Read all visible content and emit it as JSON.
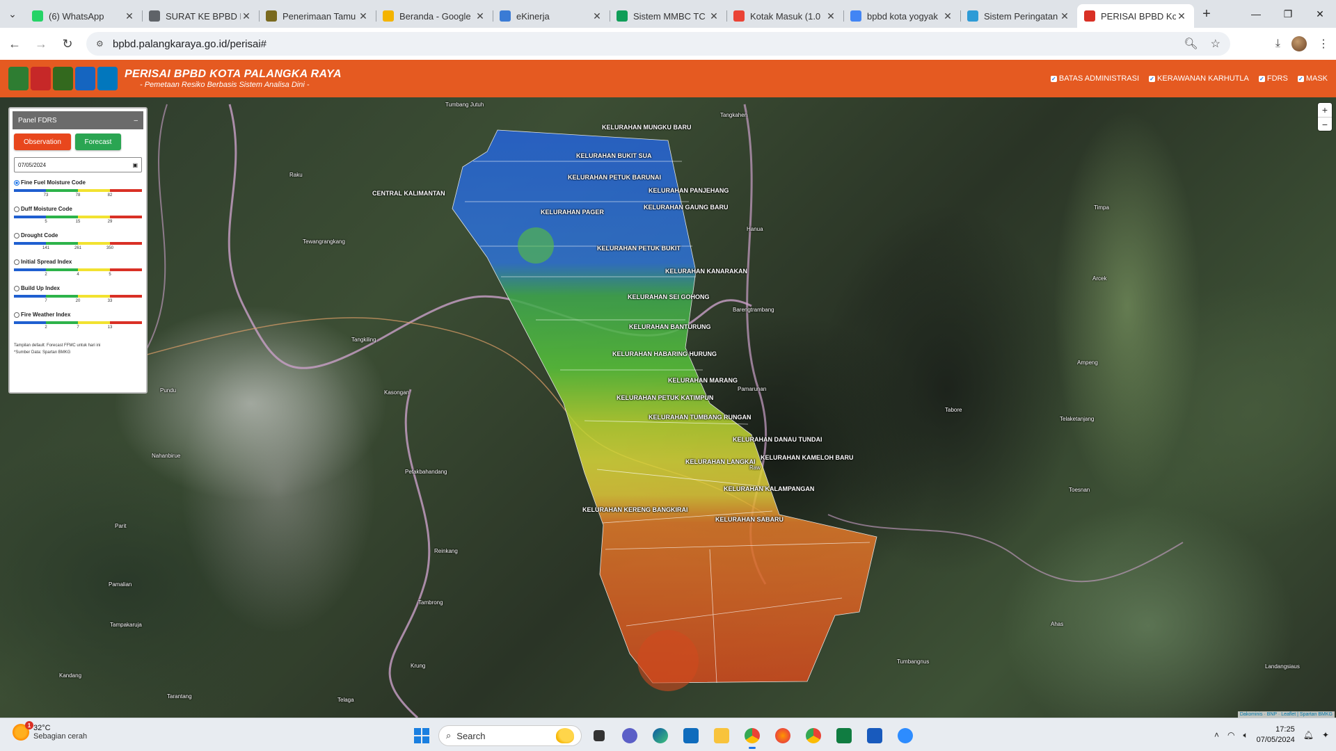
{
  "browser": {
    "tabs": [
      {
        "title": "(6) WhatsApp",
        "icon": "whatsapp-icon",
        "color": "#25d366"
      },
      {
        "title": "SURAT KE BPBD K",
        "icon": "globe-icon",
        "color": "#5f6368"
      },
      {
        "title": "Penerimaan Tamu",
        "icon": "emblem-icon",
        "color": "#7a6a1f"
      },
      {
        "title": "Beranda - Google",
        "icon": "drive-icon",
        "color": "#f4b400"
      },
      {
        "title": "eKinerja",
        "icon": "ekinerja-icon",
        "color": "#3a7bd5"
      },
      {
        "title": "Sistem MMBC TC",
        "icon": "sheets-icon",
        "color": "#0f9d58"
      },
      {
        "title": "Kotak Masuk (1.0",
        "icon": "gmail-icon",
        "color": "#ea4335"
      },
      {
        "title": "bpbd kota yogyak",
        "icon": "google-icon",
        "color": "#4285f4"
      },
      {
        "title": "Sistem Peringatan",
        "icon": "wave-icon",
        "color": "#2e9bd6"
      },
      {
        "title": "PERISAI BPBD Kot",
        "icon": "bpbd-icon",
        "color": "#d93025"
      }
    ],
    "active_tab": 9,
    "url": "bpbd.palangkaraya.go.id/perisai#"
  },
  "app": {
    "title": "PERISAI BPBD KOTA PALANGKA RAYA",
    "subtitle": "- Pemetaan Resiko Berbasis Sistem Analisa Dini -",
    "logos": [
      {
        "name": "pemkot-logo",
        "color": "#2e7d32"
      },
      {
        "name": "bpbd-logo",
        "color": "#c62828"
      },
      {
        "name": "manggala-logo",
        "color": "#33691e"
      },
      {
        "name": "bmkg-logo-1",
        "color": "#1565c0"
      },
      {
        "name": "bmkg-logo-2",
        "color": "#0277bd"
      }
    ],
    "layers": [
      "BATAS ADMINISTRASI",
      "KERAWANAN KARHUTLA",
      "FDRS",
      "MASK"
    ]
  },
  "panel": {
    "title": "Panel FDRS",
    "collapse": "–",
    "observation_label": "Observation",
    "forecast_label": "Forecast",
    "date": "07/05/2024",
    "indices": [
      {
        "name": "Fine Fuel Moisture Code",
        "selected": true,
        "ticks": [
          "73",
          "78",
          "82"
        ]
      },
      {
        "name": "Duff Moisture Code",
        "selected": false,
        "ticks": [
          "5",
          "15",
          "29"
        ]
      },
      {
        "name": "Drought Code",
        "selected": false,
        "ticks": [
          "141",
          "261",
          "350"
        ]
      },
      {
        "name": "Initial Spread Index",
        "selected": false,
        "ticks": [
          "2",
          "4",
          "5"
        ]
      },
      {
        "name": "Build Up Index",
        "selected": false,
        "ticks": [
          "7",
          "20",
          "33"
        ]
      },
      {
        "name": "Fire Weather Index",
        "selected": false,
        "ticks": [
          "2",
          "7",
          "13"
        ]
      }
    ],
    "scale_colors": [
      "#1f5fd0",
      "#2db34a",
      "#f2e230",
      "#d93025"
    ],
    "note1": "Tampilan default: Forecast FFMC untuk hari ini",
    "note2": "*Sumber Data: Spartan BMKG"
  },
  "map": {
    "kelurahan": [
      "KELURAHAN MUNGKU BARU",
      "KELURAHAN BUKIT SUA",
      "KELURAHAN PETUK BARUNAI",
      "KELURAHAN PANJEHANG",
      "KELURAHAN GAUNG BARU",
      "KELURAHAN PAGER",
      "KELURAHAN PETUK BUKIT",
      "KELURAHAN KANARAKAN",
      "KELURAHAN SEI GOHONG",
      "KELURAHAN BANTURUNG",
      "KELURAHAN HABARING HURUNG",
      "KELURAHAN MARANG",
      "KELURAHAN PETUK KATIMPUN",
      "KELURAHAN TUMBANG RUNGAN",
      "KELURAHAN DANAU TUNDAI",
      "KELURAHAN LANGKAI",
      "KELURAHAN KAMELOH BARU",
      "KELURAHAN KALAMPANGAN",
      "KELURAHAN KERENG BANGKIRAI",
      "KELURAHAN SABARU"
    ],
    "places": [
      "Tumbang Jutuh",
      "Tangkahen",
      "Raku",
      "CENTRAL KALIMANTAN",
      "Tewangrangkang",
      "Hanua",
      "Timpa",
      "Arcek",
      "Barengtrambang",
      "Tangkiling",
      "Kasongan",
      "Pamarunan",
      "Ampeng",
      "Pundu",
      "Tabore",
      "Telaketanjang",
      "Nahanbirue",
      "Petakbahandang",
      "Raw",
      "Parit",
      "Toesnan",
      "Pamalian",
      "Reinkang",
      "Tambrong",
      "Tampakaruja",
      "Kandang",
      "Krung",
      "Tarantang",
      "Telaga",
      "Ahas",
      "Tumbangnus",
      "Landangsiaus"
    ],
    "zoom_in": "+",
    "zoom_out": "−",
    "attribution": "Dakominis · BNP · Leaflet | Spartan BMKG"
  },
  "taskbar": {
    "temp": "32°C",
    "weather": "Sebagian cerah",
    "weather_badge": "1",
    "search_placeholder": "Search",
    "time": "17:25",
    "date": "07/05/2024"
  }
}
